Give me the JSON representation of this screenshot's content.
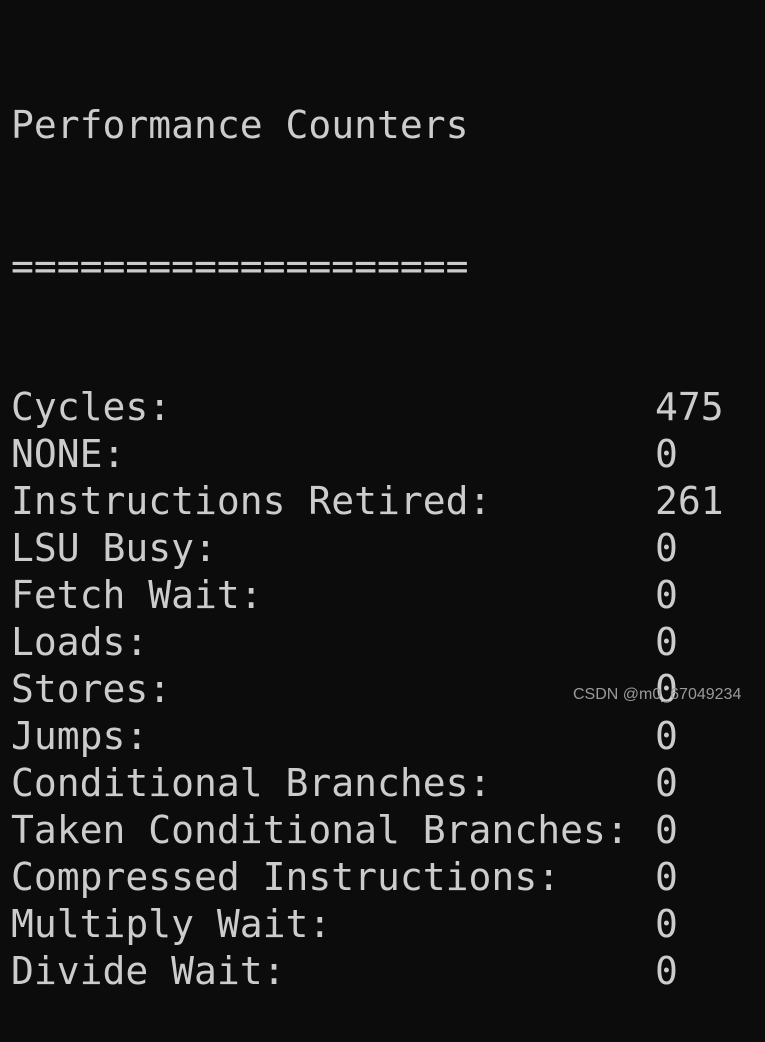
{
  "title": "Performance Counters",
  "underline": "====================",
  "counters": [
    {
      "label": "Cycles:",
      "value": "475"
    },
    {
      "label": "NONE:",
      "value": "0"
    },
    {
      "label": "Instructions Retired:",
      "value": "261"
    },
    {
      "label": "LSU Busy:",
      "value": "0"
    },
    {
      "label": "Fetch Wait:",
      "value": "0"
    },
    {
      "label": "Loads:",
      "value": "0"
    },
    {
      "label": "Stores:",
      "value": "0"
    },
    {
      "label": "Jumps:",
      "value": "0"
    },
    {
      "label": "Conditional Branches:",
      "value": "0"
    },
    {
      "label": "Taken Conditional Branches:",
      "value": "0"
    },
    {
      "label": "Compressed Instructions:",
      "value": "0"
    },
    {
      "label": "Multiply Wait:",
      "value": "0"
    },
    {
      "label": "Divide Wait:",
      "value": "0"
    }
  ],
  "watermark": "CSDN @m0_67049234",
  "colors": {
    "background": "#0c0c0c",
    "text": "#cccccc"
  }
}
